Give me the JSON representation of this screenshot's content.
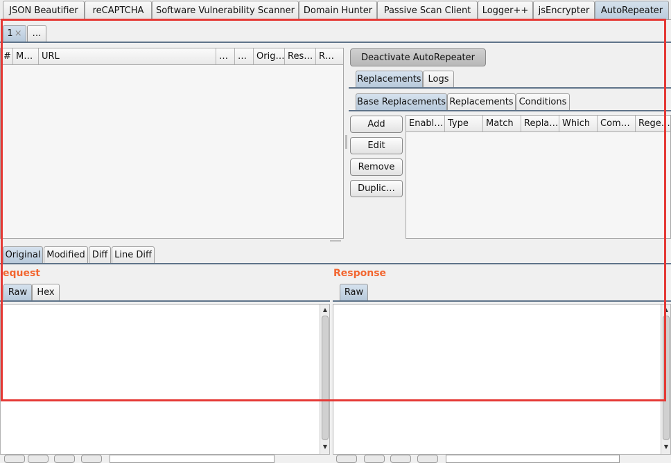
{
  "extension_tabs": [
    {
      "label": "JSON Beautifier"
    },
    {
      "label": "reCAPTCHA"
    },
    {
      "label": "Software Vulnerability Scanner"
    },
    {
      "label": "Domain Hunter"
    },
    {
      "label": "Passive Scan Client"
    },
    {
      "label": "Logger++"
    },
    {
      "label": "jsEncrypter"
    },
    {
      "label": "AutoRepeater"
    }
  ],
  "instance_tabs": {
    "first_label": "1",
    "close_glyph": "×",
    "more_label": "…"
  },
  "log_table": {
    "columns": [
      "#",
      "M…",
      "URL",
      "…",
      "…",
      "Orig…",
      "Res…",
      "R…"
    ]
  },
  "toggle_button": "Deactivate AutoRepeater",
  "config_tabs": [
    "Replacements",
    "Logs"
  ],
  "replacement_tabs": [
    "Base Replacements",
    "Replacements",
    "Conditions"
  ],
  "action_buttons": [
    "Add",
    "Edit",
    "Remove",
    "Duplic…"
  ],
  "replacements_table": {
    "columns": [
      "Enabl…",
      "Type",
      "Match",
      "Repla…",
      "Which",
      "Com…",
      "Rege…"
    ]
  },
  "view_tabs": [
    "Original",
    "Modified",
    "Diff",
    "Line Diff"
  ],
  "request": {
    "label": "equest",
    "tabs": [
      "Raw",
      "Hex"
    ]
  },
  "response": {
    "label": "Response",
    "tabs": [
      "Raw"
    ]
  },
  "colors": {
    "accent_label": "#f26630",
    "highlight_border": "#e53935",
    "active_tab": "#c6d5e4"
  }
}
